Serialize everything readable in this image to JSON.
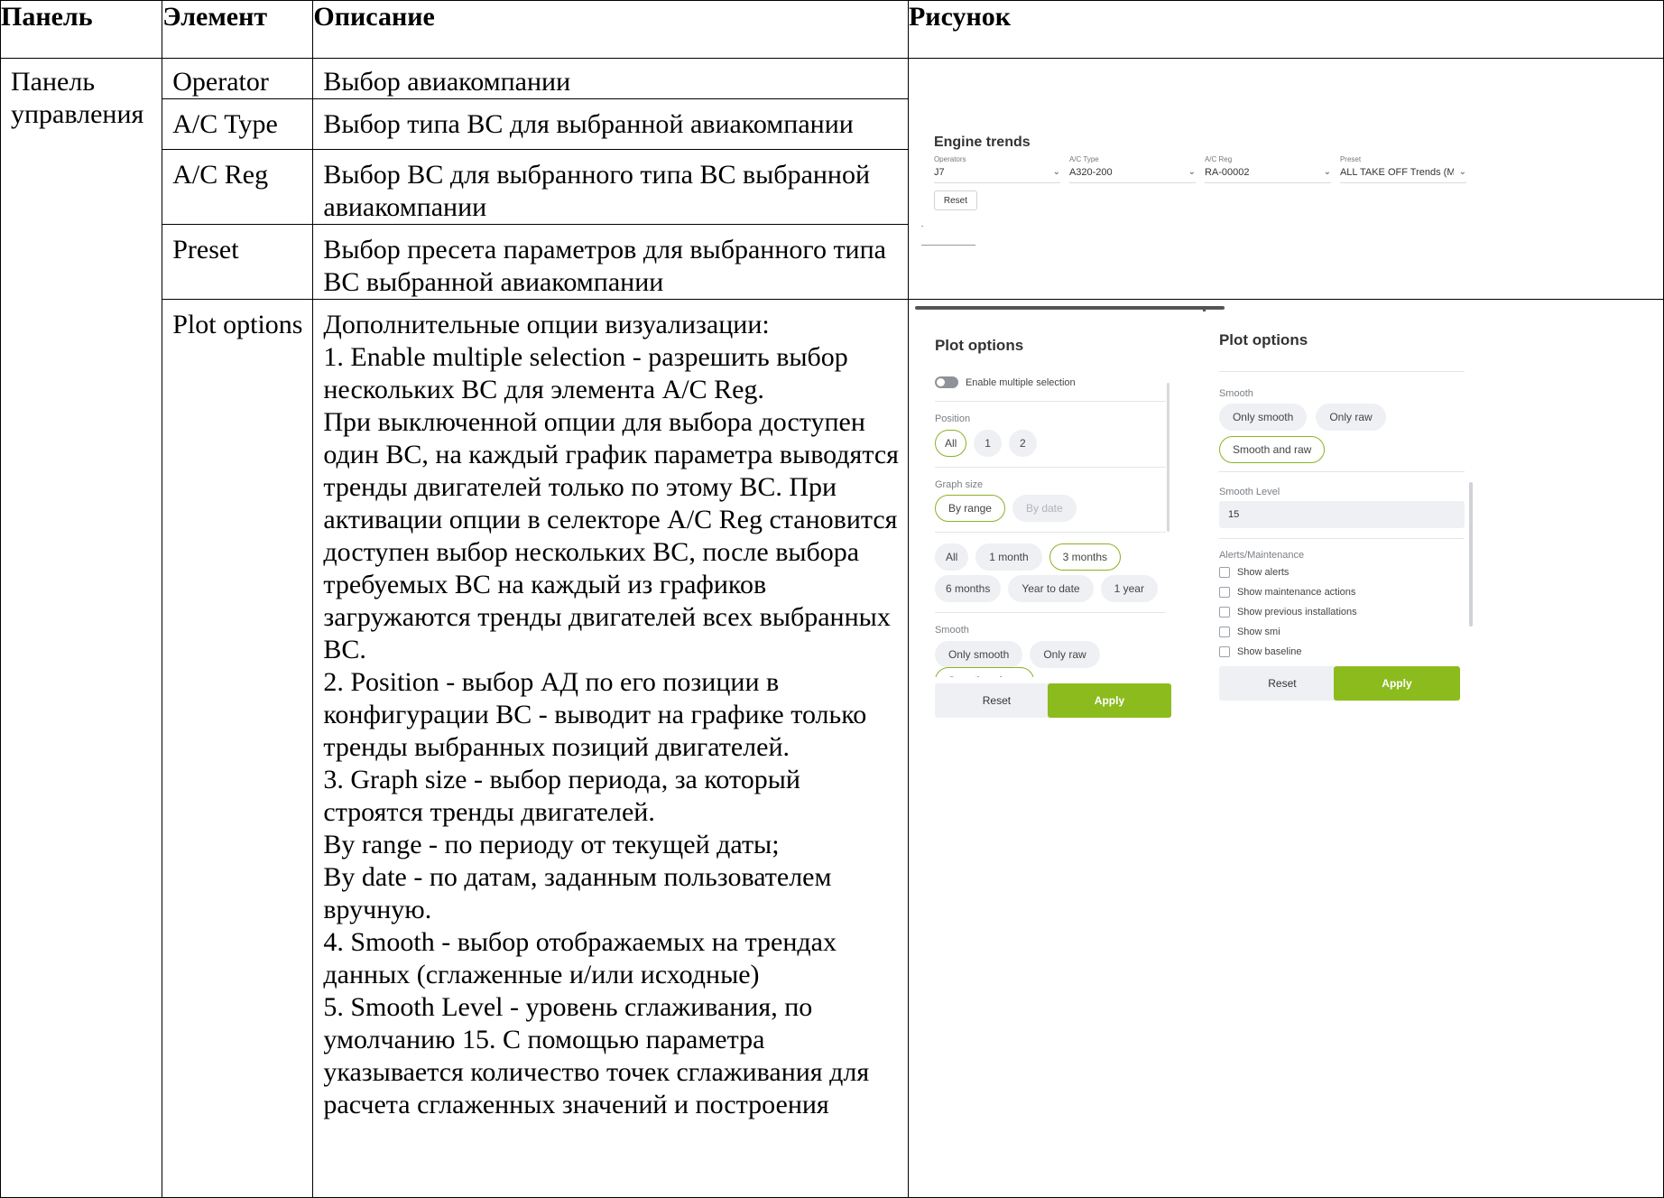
{
  "table": {
    "headers": [
      "Панель",
      "Элемент",
      "Описание",
      "Рисунок"
    ],
    "panel_name_lines": [
      "Панель",
      "управления"
    ],
    "rows": [
      {
        "element": "Operator",
        "description_lines": [
          "Выбор авиакомпании"
        ]
      },
      {
        "element": "A/C Type",
        "description_lines": [
          "Выбор типа ВС для выбранной авиакомпании"
        ]
      },
      {
        "element": "A/C Reg",
        "description_lines": [
          "Выбор ВС для выбранного типа ВС выбранной",
          "авиакомпании"
        ]
      },
      {
        "element": "Preset",
        "description_lines": [
          "Выбор пресета параметров для выбранного типа",
          "ВС выбранной авиакомпании"
        ]
      },
      {
        "element": "Plot options",
        "description_lines": [
          "Дополнительные опции визуализации:",
          "1. Enable multiple selection - разрешить выбор",
          "нескольких ВС для элемента A/C Reg.",
          "При выключенной опции для выбора доступен",
          "один ВС, на каждый график параметра выводятся",
          "тренды двигателей только по этому ВС. При",
          "активации опции в селекторе A/C Reg становится",
          "доступен выбор нескольких ВС, после выбора",
          "требуемых ВС на каждый из графиков",
          "загружаются тренды двигателей всех выбранных",
          "ВС.",
          "2. Position - выбор АД по его позиции в",
          "конфигурации ВС - выводит на графике только",
          "тренды выбранных позиций двигателей.",
          "3. Graph size - выбор периода, за который",
          "строятся тренды двигателей.",
          "By range - по периоду от текущей даты;",
          "By date - по датам, заданным пользователем",
          "вручную.",
          "4. Smooth - выбор отображаемых на трендах",
          "данных (сглаженные и/или исходные)",
          "5. Smooth Level - уровень сглаживания, по",
          "умолчанию 15. С помощью параметра",
          "указывается количество точек сглаживания для",
          "расчета сглаженных значений и построения"
        ]
      }
    ]
  },
  "engine_trends": {
    "title": "Engine trends",
    "operators": {
      "label": "Operators",
      "value": "J7"
    },
    "ac_type": {
      "label": "A/C Type",
      "value": "A320-200"
    },
    "ac_reg": {
      "label": "A/C Reg",
      "value": "RA-00002"
    },
    "preset": {
      "label": "Preset",
      "value": "ALL TAKE OFF Trends (M..."
    },
    "reset_label": "Reset"
  },
  "plot_options_left": {
    "title": "Plot options",
    "enable_multiple": "Enable multiple selection",
    "position_label": "Position",
    "position_options": [
      "All",
      "1",
      "2"
    ],
    "graph_size_label": "Graph size",
    "graph_size_modes": [
      "By range",
      "By date"
    ],
    "range_options_row1": [
      "All",
      "1 month",
      "3 months"
    ],
    "range_options_row2": [
      "6 months",
      "Year to date",
      "1 year"
    ],
    "smooth_label": "Smooth",
    "smooth_options": [
      "Only smooth",
      "Only raw",
      "Smooth and raw"
    ],
    "reset_label": "Reset",
    "apply_label": "Apply"
  },
  "plot_options_right": {
    "title": "Plot options",
    "smooth_label": "Smooth",
    "smooth_options": [
      "Only smooth",
      "Only raw",
      "Smooth and raw"
    ],
    "smooth_level_label": "Smooth Level",
    "smooth_level_value": "15",
    "alerts_label": "Alerts/Maintenance",
    "checkboxes": [
      "Show alerts",
      "Show maintenance actions",
      "Show previous installations",
      "Show smi",
      "Show baseline"
    ],
    "reset_label": "Reset",
    "apply_label": "Apply"
  },
  "colors": {
    "accent": "#8cbb1e",
    "border": "#000000"
  }
}
